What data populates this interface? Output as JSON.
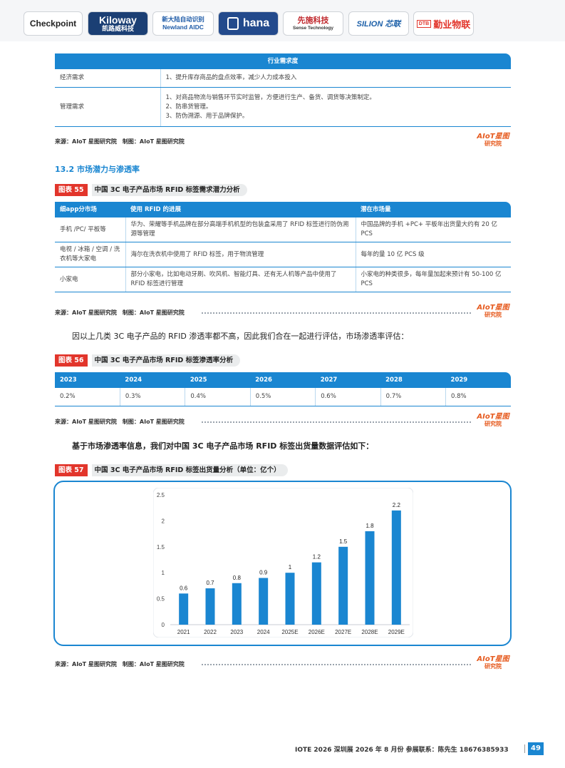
{
  "logos": [
    {
      "name": "Checkpoint",
      "color": "#222222"
    },
    {
      "name": "Kiloway",
      "sub": "凯路威科技",
      "color": "#1b5fa8"
    },
    {
      "name": "新大陆自动识别",
      "sub": "Newland AIDC",
      "color": "#1f5ca8"
    },
    {
      "name": "hana",
      "color": "#ffffff"
    },
    {
      "name": "先施科技",
      "sub": "Sense Technology",
      "color": "#c0282d"
    },
    {
      "name": "SILION 芯联",
      "color": "#1b5fa8"
    },
    {
      "name": "勤业物联",
      "sub": "DTB",
      "color": "#e2352b"
    }
  ],
  "table_demand": {
    "header": "行业需求度",
    "rows": [
      {
        "label": "经济需求",
        "lines": [
          "1、提升库存商品的盘点效率，减少人力成本投入"
        ]
      },
      {
        "label": "管理需求",
        "lines": [
          "1、对商品物流与销售环节实时监管，方便进行生产、备货、调货等决策制定。",
          "2、防串货管理。",
          "3、防伪溯源、用于品牌保护。"
        ]
      }
    ]
  },
  "source_text": "来源：AIoT 星图研究院　制图：AIoT 星图研究院",
  "watermark": {
    "line1": "AIoT星图",
    "line2": "研究院"
  },
  "section": "13.2 市场潜力与渗透率",
  "fig55": {
    "tag": "图表 55",
    "title": "中国 3C 电子产品市场 RFID 标签需求潜力分析",
    "headers": [
      "细app分市场",
      "使用 RFID 的进展",
      "潜在市场量"
    ],
    "rows": [
      [
        "手机 /PC/ 平板等",
        "华为、荣耀等手机品牌在部分高端手机机型的包装盒采用了 RFID 标签进行防伪溯源等管理",
        "中国品牌的手机 +PC+ 平板年出货量大约有 20 亿 PCS"
      ],
      [
        "电视 / 冰箱 / 空调 / 洗衣机等大家电",
        "海尔在洗衣机中使用了 RFID 标签，用于物流管理",
        "每年的量 10 亿 PCS 级"
      ],
      [
        "小家电",
        "部分小家电，比如电动牙刷、吹风机、智能灯具、还有无人机等产品中使用了 RFID 标签进行管理",
        "小家电的种类很多，每年量加起来预计有 50-100 亿 PCS"
      ]
    ]
  },
  "para1": "因以上几类 3C 电子产品的 RFID 渗透率都不高，因此我们合在一起进行评估，市场渗透率评估：",
  "fig56": {
    "tag": "图表 56",
    "title": "中国 3C 电子产品市场 RFID 标签渗透率分析",
    "years": [
      "2023",
      "2024",
      "2025",
      "2026",
      "2027",
      "2028",
      "2029"
    ],
    "rates": [
      "0.2%",
      "0.3%",
      "0.4%",
      "0.5%",
      "0.6%",
      "0.7%",
      "0.8%"
    ]
  },
  "para2": "基于市场渗透率信息，我们对中国 3C 电子产品市场 RFID 标签出货量数据评估如下：",
  "fig57": {
    "tag": "图表 57",
    "title": "中国 3C 电子产品市场 RFID 标签出货量分析（单位：亿个）"
  },
  "chart_data": {
    "type": "bar",
    "categories": [
      "2021",
      "2022",
      "2023",
      "2024",
      "2025E",
      "2026E",
      "2027E",
      "2028E",
      "2029E"
    ],
    "values": [
      0.6,
      0.7,
      0.8,
      0.9,
      1,
      1.2,
      1.5,
      1.8,
      2.2
    ],
    "value_labels": [
      "0.6",
      "0.7",
      "0.8",
      "0.9",
      "1",
      "1.2",
      "1.5",
      "1.8",
      "2.2"
    ],
    "yticks": [
      "0",
      "0.5",
      "1",
      "1.5",
      "2",
      "2.5"
    ],
    "ylim": [
      0,
      2.5
    ],
    "bar_color": "#1a86d1",
    "grid": false
  },
  "footer": "IOTE 2026 深圳展 2026 年 8 月份  参展联系：陈先生 18676385933",
  "page_number": "49",
  "colors": {
    "accent": "#1a86d1",
    "tag": "#e2352b"
  }
}
